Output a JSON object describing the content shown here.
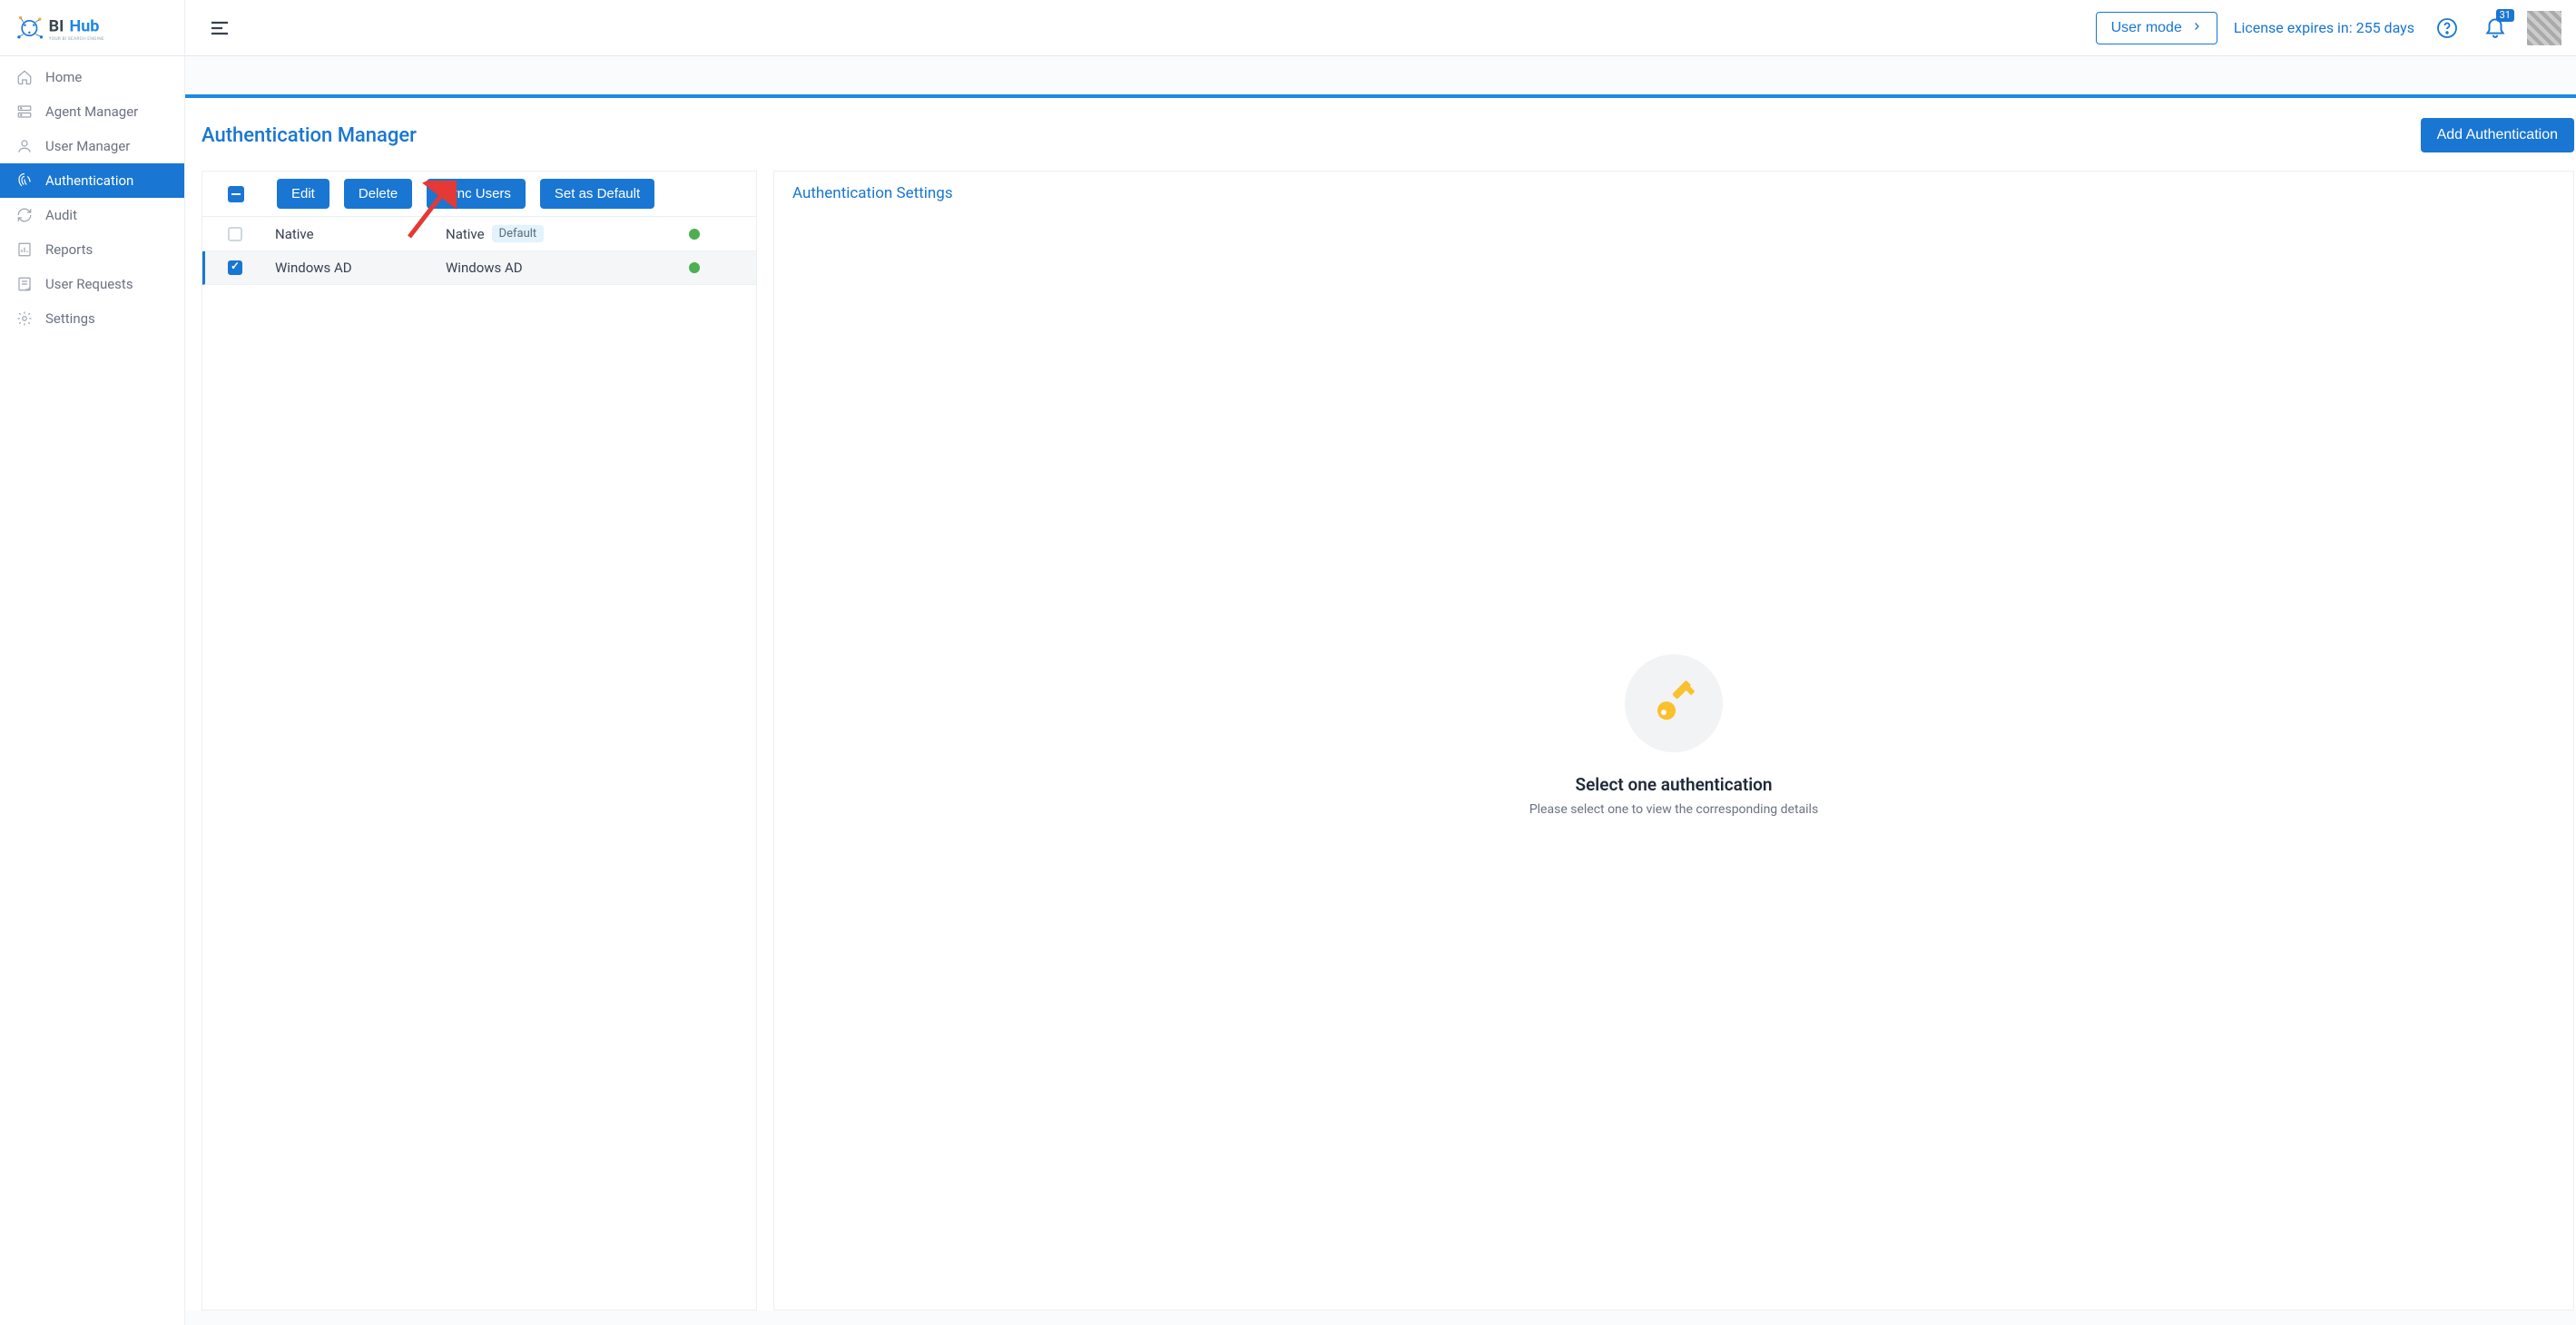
{
  "brand": {
    "name": "BI Hub",
    "tagline": "YOUR BI SEARCH ENGINE"
  },
  "header": {
    "user_mode_label": "User mode",
    "license_text": "License expires in: 255 days",
    "notification_count": "31"
  },
  "sidebar": {
    "items": [
      {
        "label": "Home",
        "icon": "home-icon"
      },
      {
        "label": "Agent Manager",
        "icon": "server-icon"
      },
      {
        "label": "User Manager",
        "icon": "user-icon"
      },
      {
        "label": "Authentication",
        "icon": "fingerprint-icon",
        "active": true
      },
      {
        "label": "Audit",
        "icon": "refresh-icon"
      },
      {
        "label": "Reports",
        "icon": "report-icon"
      },
      {
        "label": "User Requests",
        "icon": "request-icon"
      },
      {
        "label": "Settings",
        "icon": "gear-icon"
      }
    ]
  },
  "page": {
    "title": "Authentication Manager",
    "add_button": "Add Authentication"
  },
  "toolbar": {
    "edit": "Edit",
    "delete": "Delete",
    "sync_users": "Sync Users",
    "set_default": "Set as Default"
  },
  "table": {
    "rows": [
      {
        "name": "Native",
        "type": "Native",
        "is_default": true,
        "status": "active",
        "checked": false
      },
      {
        "name": "Windows AD",
        "type": "Windows AD",
        "is_default": false,
        "status": "active",
        "checked": true
      }
    ],
    "default_label": "Default"
  },
  "settings_panel": {
    "title": "Authentication Settings",
    "empty_title": "Select one authentication",
    "empty_subtitle": "Please select one to view the corresponding details"
  }
}
